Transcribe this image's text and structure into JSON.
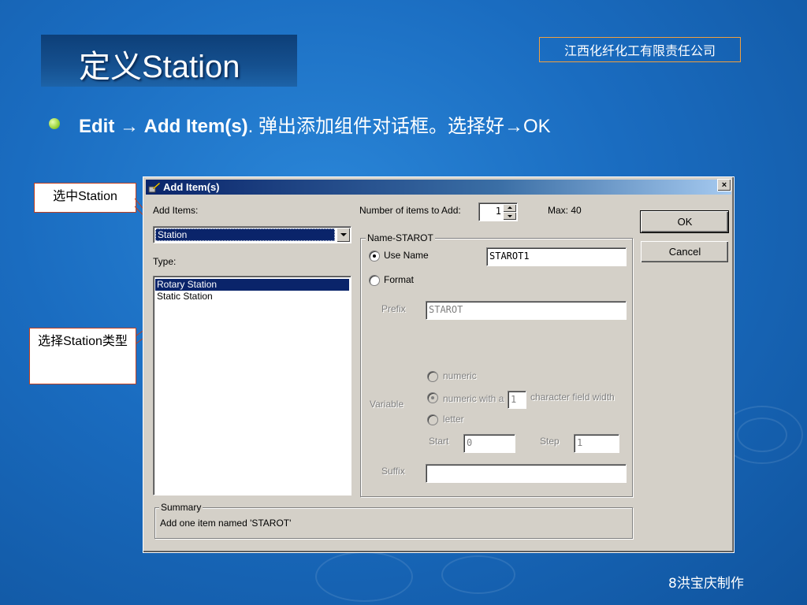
{
  "slide": {
    "title": "定义Station",
    "company": "江西化纤化工有限责任公司",
    "bullet": {
      "edit": "Edit",
      "arrow": "→",
      "add_items": "Add Item(s)",
      "period": ".",
      "desc": " 弹出添加组件对话框。选择好",
      "arrow2": "→",
      "ok": "OK"
    },
    "footer": "8洪宝庆制作",
    "callouts": {
      "select_station": "选中Station",
      "choose_type": "选择Station类型"
    }
  },
  "dialog": {
    "title": "Add Item(s)",
    "close": "×",
    "add_items_label": "Add Items:",
    "add_items_value": "Station",
    "type_label": "Type:",
    "type_list": [
      "Rotary Station",
      "Static Station"
    ],
    "selected_type_index": 0,
    "number_label": "Number of items to Add:",
    "number_value": "1",
    "max_label": "Max:  40",
    "name_group_title": "Name-STAROT",
    "use_name_label": "Use Name",
    "use_name_value": "STAROT1",
    "format_label": "Format",
    "prefix_label": "Prefix",
    "prefix_value": "STAROT",
    "variable_label": "Variable",
    "numeric_label": "numeric",
    "numeric_width_label": "numeric with a",
    "width_value": "1",
    "char_width_label": "character field width",
    "letter_label": "letter",
    "start_label": "Start",
    "start_value": "0",
    "step_label": "Step",
    "step_value": "1",
    "suffix_label": "Suffix",
    "suffix_value": "",
    "ok_label": "OK",
    "cancel_label": "Cancel",
    "summary_title": "Summary",
    "summary_text": "Add one item named  'STAROT'"
  }
}
